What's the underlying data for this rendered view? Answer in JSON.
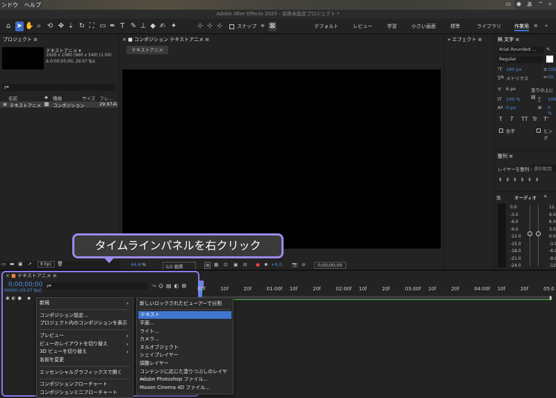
{
  "menubar": {
    "app_menu": "ンドウ",
    "help_menu": "ヘルプ",
    "input_indicator": "あ"
  },
  "window_title": "Adobe After Effects 2025 - 名称未設定プロジェクト *",
  "toolbar": {
    "snap_label": "スナップ",
    "workspaces": [
      "デフォルト",
      "レビュー",
      "学習",
      "小さい画面",
      "標準",
      "ライブラリ",
      "作業用"
    ]
  },
  "project_panel": {
    "tab": "プロジェクト",
    "comp_name": "テキストアニメ ▾",
    "comp_size": "1920 x 1080  (960 x 540) (1.00)",
    "comp_duration": "Δ 0;00;05;00, 29.97 fps",
    "search_placeholder": "ρ▾",
    "columns": [
      "名前",
      "種類",
      "サイズ",
      "フレ..."
    ],
    "item_name": "テキストアニメ",
    "item_type": "コンポジション",
    "item_fps": "29.97",
    "bpc": "8 bpc"
  },
  "comp_panel": {
    "tab": "コンポジション テキストアニメ",
    "sub_tab": "テキストアニメ",
    "zoom": "44.8",
    "zoom_unit": "%",
    "quality": "1/2 画質",
    "exposure": "+0.0",
    "timecode": "0;00;00;00"
  },
  "effects_panel": {
    "tab": "エフェクト"
  },
  "character_panel": {
    "tab": "文字",
    "font": "Arial Rounded ...",
    "style": "Regular",
    "size": "180 px",
    "leading": "195",
    "kerning": "メトリクス",
    "tracking": "50",
    "indent": "6 px",
    "fill": "塗りの上に線",
    "vscale": "100 %",
    "hscale": "100",
    "baseline": "0 px",
    "tsume": "0 %",
    "styles": [
      "T",
      "T",
      "TT",
      "Tr",
      "T'"
    ],
    "ligature": "合字",
    "hindi": "ヒンデ"
  },
  "align_panel": {
    "tab": "整列",
    "label": "レイヤーを整列 :",
    "target": "選択範囲"
  },
  "audio_panel": {
    "tab": "オーディオ",
    "left_label": "落",
    "levels": [
      "0.0",
      "-3.0",
      "-6.0",
      "-9.0",
      "-12.0",
      "-15.0",
      "-18.0",
      "-21.0",
      "-24.0"
    ],
    "right_levels": [
      "12.0",
      "9.0",
      "6.0",
      "3.0",
      "0.0",
      "-3.0",
      "-6.0",
      "-9.0",
      "-12.0"
    ]
  },
  "timeline": {
    "tab": "テキストアニメ",
    "timecode": "0;00;00;00",
    "fps": "00000 (29.97 fps)",
    "search": "ρ▾",
    "ruler": [
      "00f",
      "10f",
      "20f",
      "01:00f",
      "10f",
      "20f",
      "02:00f",
      "10f",
      "20f",
      "03:00f",
      "10f",
      "20f",
      "04:00f",
      "10f",
      "20f",
      "05:0"
    ]
  },
  "callout": "タイムラインパネルを右クリック",
  "context_menu": {
    "items": [
      {
        "label": "新規",
        "submenu": true
      },
      {
        "label": "コンポジション設定..."
      },
      {
        "label": "プロジェクト内のコンポジションを表示"
      },
      {
        "label": "プレビュー",
        "submenu": true
      },
      {
        "label": "ビューのレイアウトを切り替え",
        "submenu": true
      },
      {
        "label": "3D ビューを切り替え",
        "submenu": true
      },
      {
        "label": "名前を変更"
      },
      {
        "label": "エッセンシャルグラフィックスで開く"
      },
      {
        "label": "コンポジションフローチャート"
      },
      {
        "label": "コンポジションミニフローチャート"
      }
    ]
  },
  "submenu": {
    "header": "新しいロックされたビューアーで分割",
    "items": [
      "テキスト",
      "平面...",
      "ライト...",
      "カメラ...",
      "ヌルオブジェクト",
      "シェイプレイヤー",
      "調整レイヤー",
      "コンテンツに応じた塗りつぶしのレイヤー...",
      "Adobe Photoshop ファイル...",
      "Maxon Cinema 4D ファイル..."
    ]
  },
  "colors": {
    "accent": "#3f75cf",
    "callout_border": "#9d8cf0",
    "panel": "#232323",
    "timecode": "#4f8fe6",
    "highlight_frame": "#8d7cf0"
  }
}
